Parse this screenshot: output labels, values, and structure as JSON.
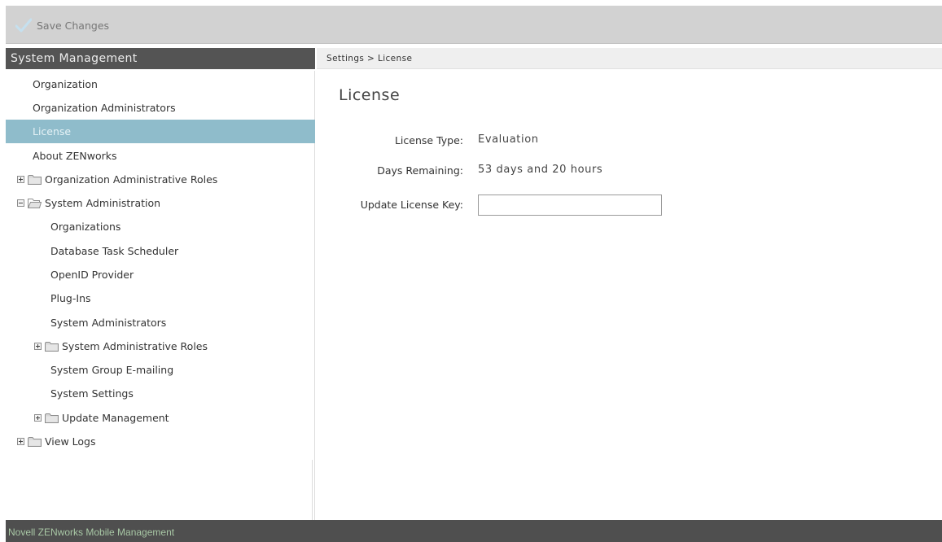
{
  "toolbar": {
    "save_label": "Save Changes"
  },
  "sidebar": {
    "title": "System Management",
    "items": [
      {
        "label": "Organization"
      },
      {
        "label": "Organization Administrators"
      },
      {
        "label": "License",
        "selected": true
      },
      {
        "label": "About ZENworks"
      },
      {
        "label": "Organization Administrative Roles",
        "expandable": true,
        "expanded": false
      },
      {
        "label": "System Administration",
        "expandable": true,
        "expanded": true
      },
      {
        "label": "Organizations"
      },
      {
        "label": "Database Task Scheduler"
      },
      {
        "label": "OpenID Provider"
      },
      {
        "label": "Plug-Ins"
      },
      {
        "label": "System Administrators"
      },
      {
        "label": "System Administrative Roles",
        "expandable": true,
        "expanded": false
      },
      {
        "label": "System Group E-mailing"
      },
      {
        "label": "System Settings"
      },
      {
        "label": "Update Management",
        "expandable": true,
        "expanded": false
      },
      {
        "label": "View Logs",
        "expandable": true,
        "expanded": false
      }
    ]
  },
  "breadcrumb": "Settings > License",
  "main": {
    "title": "License",
    "license_type_label": "License Type:",
    "license_type_value": "Evaluation",
    "days_remaining_label": "Days Remaining:",
    "days_remaining_value": "53 days and 20 hours",
    "update_key_label": "Update License Key:",
    "update_key_value": ""
  },
  "footer": {
    "text": "Novell ZENworks Mobile Management"
  },
  "colors": {
    "toolbar_bg": "#d2d2d2",
    "sidebar_header_bg": "#545454",
    "selected_item_bg": "#8fbccb",
    "footer_bg": "#4f4f4f",
    "footer_text": "#a8c7a5",
    "checkmark": "#c5e0ef"
  },
  "icons": {
    "save": "checkmark-icon",
    "tree_collapsed": "plus-box-icon",
    "tree_expanded": "minus-box-icon",
    "folder_closed": "folder-icon",
    "folder_open": "folder-open-icon"
  }
}
